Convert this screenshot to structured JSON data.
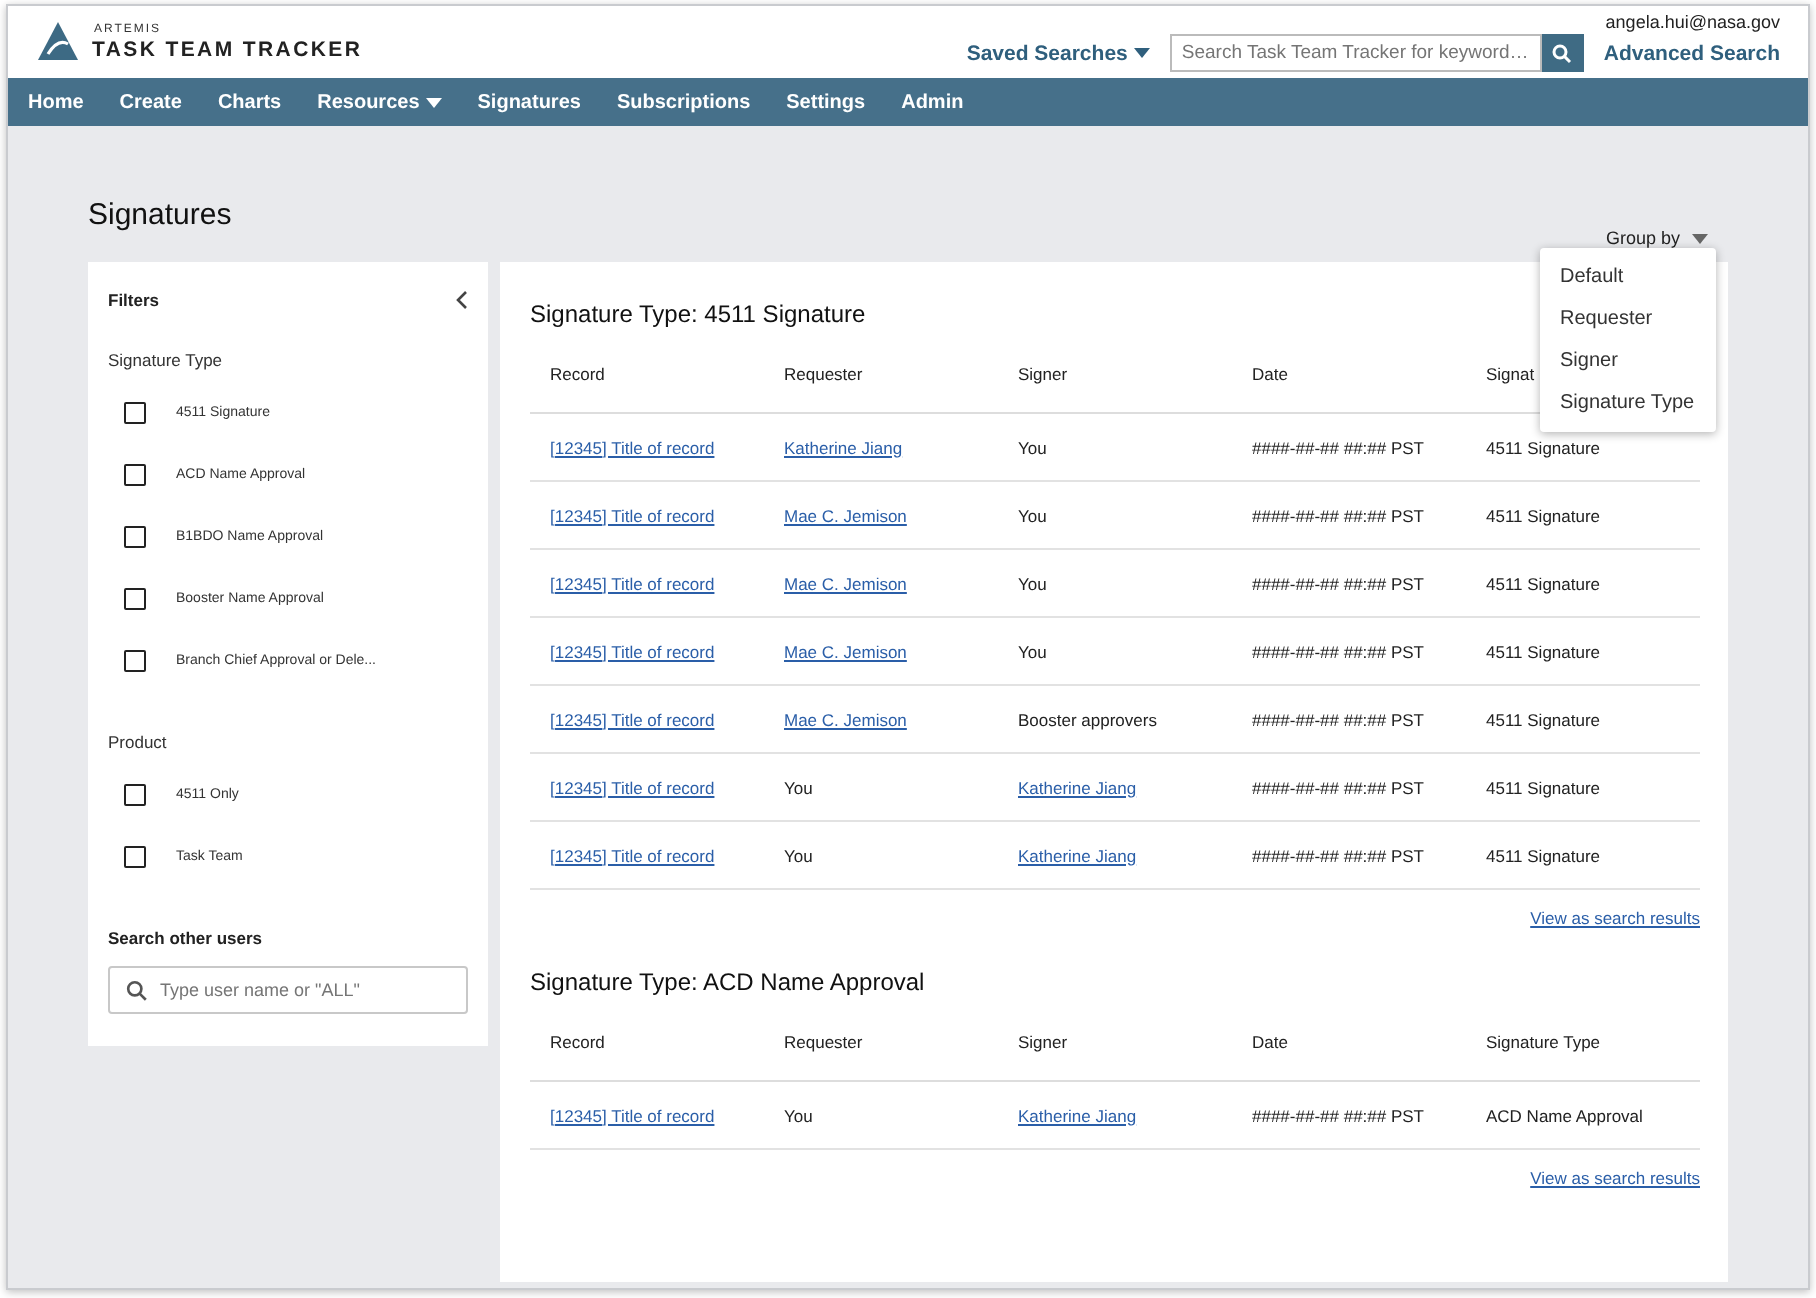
{
  "header": {
    "brand_top": "ARTEMIS",
    "brand": "TASK TEAM TRACKER",
    "user": "angela.hui@nasa.gov",
    "saved_searches": "Saved Searches",
    "search_placeholder": "Search Task Team Tracker for keyword…",
    "advanced": "Advanced Search"
  },
  "nav": [
    {
      "label": "Home",
      "dropdown": false
    },
    {
      "label": "Create",
      "dropdown": false
    },
    {
      "label": "Charts",
      "dropdown": false
    },
    {
      "label": "Resources",
      "dropdown": true
    },
    {
      "label": "Signatures",
      "dropdown": false
    },
    {
      "label": "Subscriptions",
      "dropdown": false
    },
    {
      "label": "Settings",
      "dropdown": false
    },
    {
      "label": "Admin",
      "dropdown": false
    }
  ],
  "page_title": "Signatures",
  "group_by": {
    "label": "Group by",
    "options": [
      {
        "label": "Default",
        "selected": false
      },
      {
        "label": "Requester",
        "selected": false
      },
      {
        "label": "Signer",
        "selected": false
      },
      {
        "label": "Signature Type",
        "selected": false
      }
    ]
  },
  "filters": {
    "title": "Filters",
    "sections": [
      {
        "title": "Signature Type",
        "items": [
          {
            "label": "4511 Signature",
            "checked": false
          },
          {
            "label": "ACD Name Approval",
            "checked": false
          },
          {
            "label": "B1BDO Name Approval",
            "checked": false
          },
          {
            "label": "Booster Name Approval",
            "checked": false
          },
          {
            "label": "Branch Chief Approval or Dele...",
            "checked": false
          }
        ]
      },
      {
        "title": "Product",
        "items": [
          {
            "label": "4511 Only",
            "checked": false
          },
          {
            "label": "Task Team",
            "checked": false
          }
        ]
      }
    ],
    "search_title": "Search other users",
    "search_placeholder": "Type user name or \"ALL\""
  },
  "groups": [
    {
      "title": "Signature Type: 4511 Signature",
      "columns": [
        "Record",
        "Requester",
        "Signer",
        "Date",
        "Signat"
      ],
      "rows": [
        {
          "record": "[12345] Title of record",
          "requester": {
            "text": "Katherine Jiang",
            "link": true
          },
          "signer": {
            "text": "You",
            "link": false
          },
          "date": "####-##-## ##:## PST",
          "type": "4511 Signature"
        },
        {
          "record": "[12345] Title of record",
          "requester": {
            "text": "Mae C. Jemison",
            "link": true
          },
          "signer": {
            "text": "You",
            "link": false
          },
          "date": "####-##-## ##:## PST",
          "type": "4511 Signature"
        },
        {
          "record": "[12345] Title of record",
          "requester": {
            "text": "Mae C. Jemison",
            "link": true
          },
          "signer": {
            "text": "You",
            "link": false
          },
          "date": "####-##-## ##:## PST",
          "type": "4511 Signature"
        },
        {
          "record": "[12345] Title of record",
          "requester": {
            "text": "Mae C. Jemison",
            "link": true
          },
          "signer": {
            "text": "You",
            "link": false
          },
          "date": "####-##-## ##:## PST",
          "type": "4511 Signature"
        },
        {
          "record": "[12345] Title of record",
          "requester": {
            "text": "Mae C. Jemison",
            "link": true
          },
          "signer": {
            "text": "Booster approvers",
            "link": false
          },
          "date": "####-##-## ##:## PST",
          "type": "4511 Signature"
        },
        {
          "record": "[12345] Title of record",
          "requester": {
            "text": "You",
            "link": false
          },
          "signer": {
            "text": "Katherine Jiang",
            "link": true
          },
          "date": "####-##-## ##:## PST",
          "type": "4511 Signature"
        },
        {
          "record": "[12345] Title of record",
          "requester": {
            "text": "You",
            "link": false
          },
          "signer": {
            "text": "Katherine Jiang",
            "link": true
          },
          "date": "####-##-## ##:## PST",
          "type": "4511 Signature"
        }
      ],
      "more": "View as search results"
    },
    {
      "title": "Signature Type: ACD Name Approval",
      "columns": [
        "Record",
        "Requester",
        "Signer",
        "Date",
        "Signature Type"
      ],
      "rows": [
        {
          "record": "[12345] Title of record",
          "requester": {
            "text": "You",
            "link": false
          },
          "signer": {
            "text": "Katherine Jiang",
            "link": true
          },
          "date": "####-##-## ##:## PST",
          "type": "ACD Name Approval"
        }
      ],
      "more": "View as search results"
    }
  ]
}
